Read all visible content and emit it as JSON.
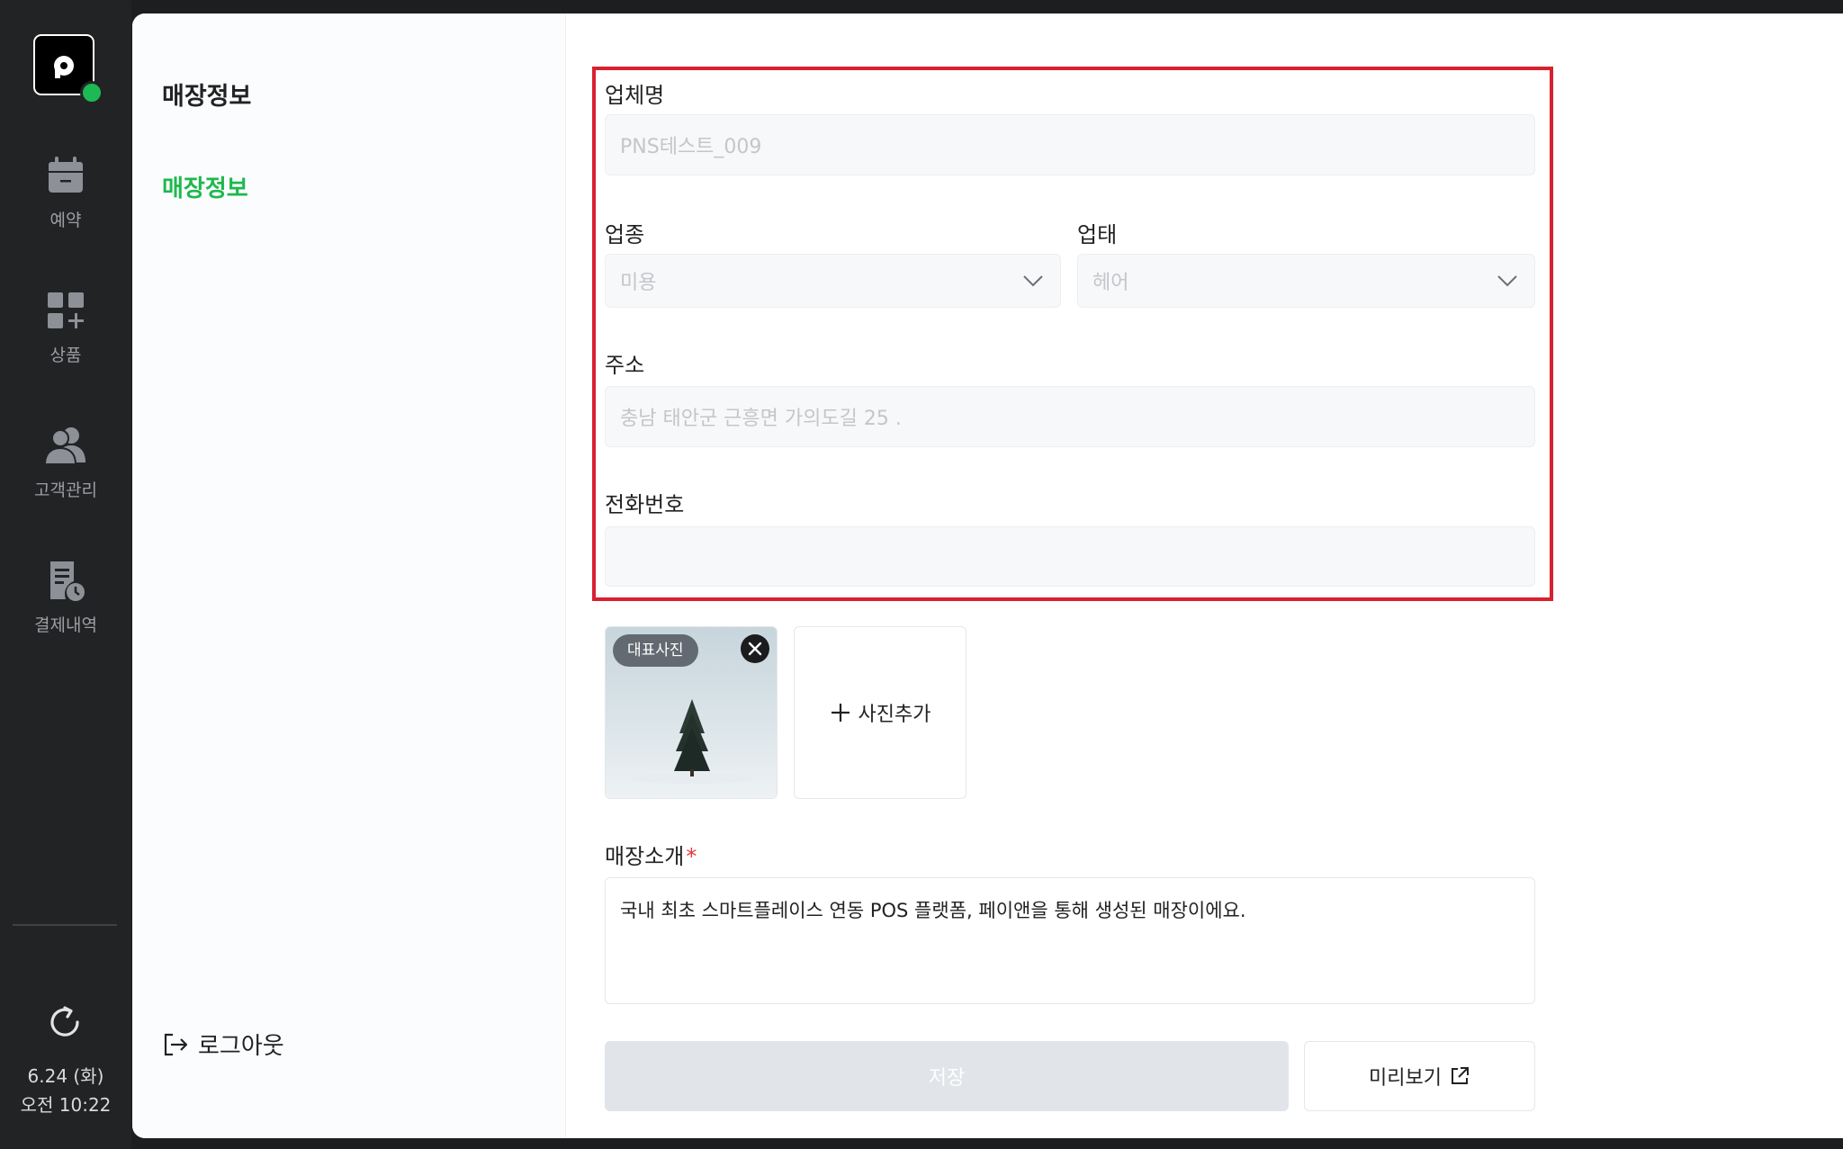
{
  "sidebar": {
    "logo_letter": "p",
    "items": [
      {
        "label": "예약",
        "icon": "calendar-icon"
      },
      {
        "label": "상품",
        "icon": "grid-plus-icon"
      },
      {
        "label": "고객관리",
        "icon": "users-icon"
      },
      {
        "label": "결제내역",
        "icon": "receipt-clock-icon"
      }
    ],
    "date": "6.24 (화)",
    "time": "오전 10:22"
  },
  "subnav": {
    "title": "매장정보",
    "items": [
      {
        "label": "매장정보",
        "active": true
      }
    ],
    "logout_label": "로그아웃"
  },
  "form": {
    "business_name": {
      "label": "업체명",
      "placeholder": "PNS테스트_009"
    },
    "category": {
      "label": "업종",
      "value": "미용"
    },
    "business_type": {
      "label": "업태",
      "value": "헤어"
    },
    "address": {
      "label": "주소",
      "placeholder": "충남 태안군 근흥면 가의도길 25 ."
    },
    "phone": {
      "label": "전화번호",
      "placeholder": ""
    },
    "photos": {
      "main_badge": "대표사진",
      "add_label": "사진추가"
    },
    "intro": {
      "label": "매장소개",
      "required_mark": "*",
      "value": "국내 최초 스마트플레이스 연동 POS 플랫폼, 페이앤을 통해 생성된 매장이에요."
    },
    "save_label": "저장",
    "preview_label": "미리보기"
  },
  "colors": {
    "accent": "#1eb84e",
    "highlight": "#d9202f",
    "rail_bg": "#222325"
  }
}
